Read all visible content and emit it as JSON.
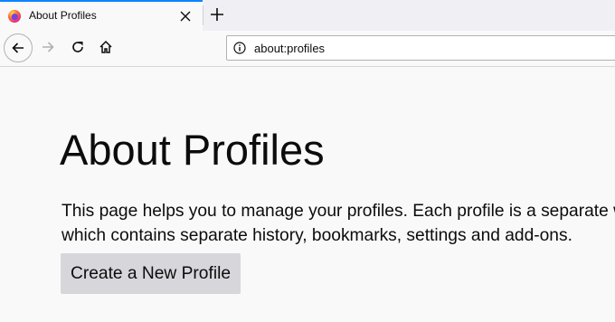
{
  "tab": {
    "title": "About Profiles",
    "favicon": "firefox-logo-icon",
    "close_icon": "close-icon"
  },
  "toolbar": {
    "new_tab_icon": "plus-icon",
    "back_icon": "back-arrow-icon",
    "forward_icon": "forward-arrow-icon",
    "reload_icon": "reload-icon",
    "home_icon": "home-icon"
  },
  "urlbar": {
    "info_icon": "info-icon",
    "url": "about:profiles"
  },
  "page": {
    "title": "About Profiles",
    "description_line1": "This page helps you to manage your profiles. Each profile is a separate world",
    "description_line2": "which contains separate history, bookmarks, settings and add-ons.",
    "create_button_label": "Create a New Profile"
  },
  "colors": {
    "accent": "#0a84ff",
    "button_bg": "#d7d7db",
    "page_bg": "#f9f9fa"
  }
}
